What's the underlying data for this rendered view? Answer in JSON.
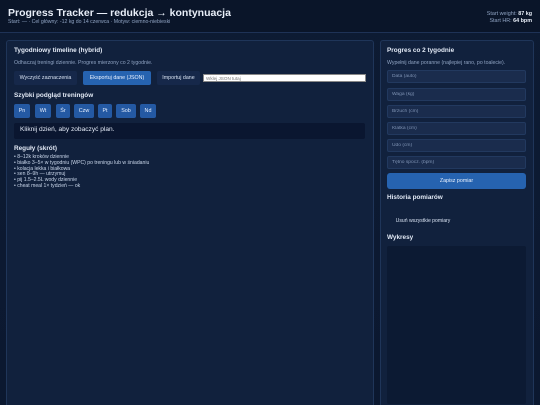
{
  "header": {
    "title": "Progress Tracker — redukcja → kontynuacja",
    "subtitle": "Start: — · Cel główny: -12 kg do 14 czerwca · Motyw: ciemno-niebieski",
    "start_weight_label": "Start weight:",
    "start_weight_value": "87 kg",
    "start_hr_label": "Start HR:",
    "start_hr_value": "64 bpm"
  },
  "timeline": {
    "title": "Tygodniowy timeline (hybrid)",
    "description": "Odhaczaj treningi dziennie. Progres mierzony co 2 tygodnie.",
    "clear_button": "Wyczyść zaznaczenia",
    "export_button": "Eksportuj dane (JSON)",
    "import_button": "Importuj dane",
    "json_placeholder": "Wklej JSON tutaj"
  },
  "quick_view": {
    "title": "Szybki podgląd treningów",
    "days": [
      "Pn",
      "Wt",
      "Śr",
      "Czw",
      "Pt",
      "Sob",
      "Nd"
    ],
    "plan_prompt": "Kliknij dzień, aby zobaczyć plan."
  },
  "rules": {
    "title": "Reguły (skrót)",
    "items": [
      "• 8–12k kroków dziennie",
      "• białko 3–5× w tygodniu (WPC) po treningu lub w śniadaniu",
      "• kolacja lekka i białkowa",
      "• sen 8–9h — utrzymuj",
      "• pij 1.5–2.5L wody dziennie",
      "• cheat meal 1× tydzień — ok"
    ]
  },
  "progress": {
    "title": "Progres co 2 tygodnie",
    "description": "Wypełnij dane poranne (najlepiej rano, po toalecie).",
    "fields": [
      "Data (auto)",
      "Waga (kg)",
      "Brzuch (cm)",
      "Klatka (cm)",
      "Udo (cm)",
      "Tętno spocz. (bpm)"
    ],
    "save_button": "Zapisz pomiar"
  },
  "history": {
    "title": "Historia pomiarów",
    "clear_button": "Usuń wszystkie pomiary"
  },
  "charts": {
    "title": "Wykresy"
  }
}
